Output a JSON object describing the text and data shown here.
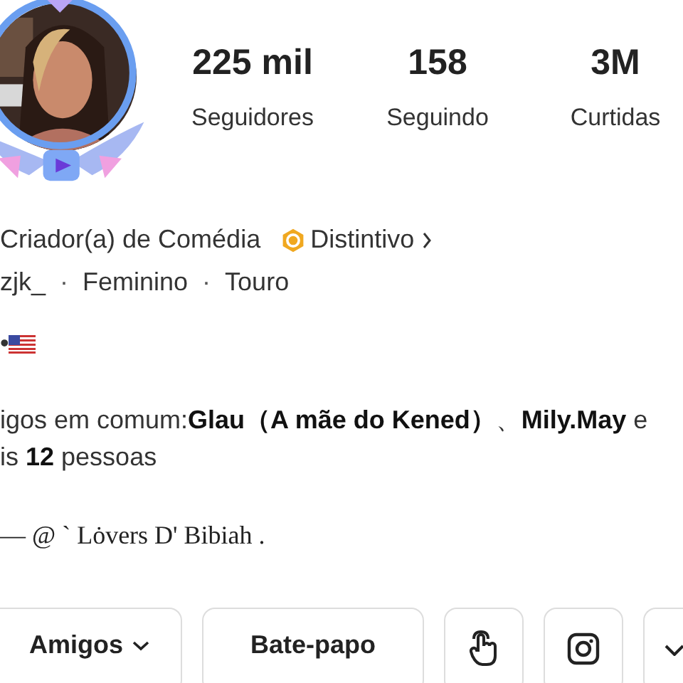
{
  "profile": {
    "avatar": {
      "kind": "picture"
    },
    "stats": [
      {
        "value": "225 mil",
        "label": "Seguidores"
      },
      {
        "value": "158",
        "label": "Seguindo"
      },
      {
        "value": "3M",
        "label": "Curtidas"
      }
    ],
    "category": "Criador(a) de Comédia",
    "badge": {
      "label": "Distintivo"
    },
    "details": [
      "zjk_",
      "Feminino",
      "Touro"
    ],
    "separator": "·",
    "location": "•",
    "mutual": [
      "igos em comum:**Glau（A mãe do Kened）**、**Mily.May** e",
      "is **12** pessoas"
    ],
    "bio": "— @ ` Lȯvers D' Bibiah ."
  },
  "buttons": [
    {
      "kind": "dropdown",
      "label": "Amigos"
    },
    {
      "kind": "text",
      "label": "Bate-papo"
    },
    {
      "kind": "tap"
    },
    {
      "kind": "instagram"
    },
    {
      "kind": "more"
    }
  ]
}
